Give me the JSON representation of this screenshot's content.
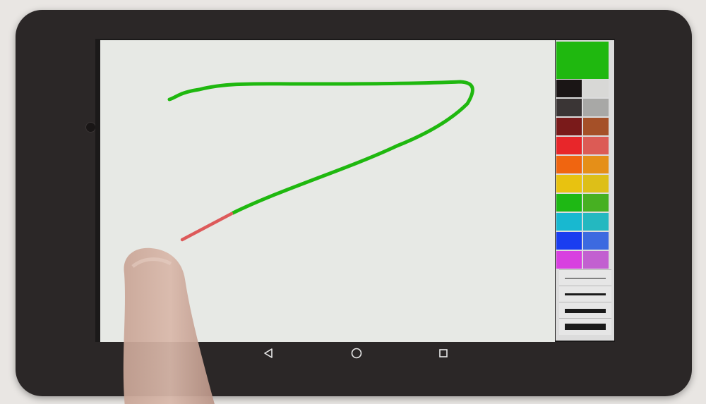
{
  "app": {
    "current_color": "#1fb80f",
    "stroke_color": "#1fb80f",
    "stroke_tail_color": "#dd5a5a"
  },
  "palette": {
    "colors": [
      [
        "#1a1515",
        "#d8d8d6"
      ],
      [
        "#3a3535",
        "#a8a8a6"
      ],
      [
        "#7a1a1a",
        "#a55028"
      ],
      [
        "#e8262a",
        "#dc5b55"
      ],
      [
        "#f06510",
        "#e58f18"
      ],
      [
        "#e8c210",
        "#ddbf18"
      ],
      [
        "#1eb814",
        "#47b022"
      ],
      [
        "#18b8d0",
        "#24b8c0"
      ],
      [
        "#1a3df0",
        "#3c6ae0"
      ],
      [
        "#d840e0",
        "#c260d0"
      ]
    ],
    "brush_sizes": [
      "thin",
      "medium",
      "thick",
      "extra-thick"
    ]
  },
  "navigation": {
    "back_icon": "back-triangle-icon",
    "home_icon": "home-circle-icon",
    "recents_icon": "recents-square-icon"
  }
}
